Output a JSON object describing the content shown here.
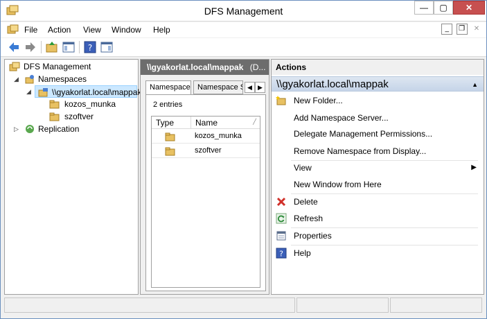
{
  "window": {
    "title": "DFS Management"
  },
  "titlebar": {
    "minimize": "—",
    "restore": "▢",
    "close": "✕"
  },
  "menu": {
    "items": [
      "File",
      "Action",
      "View",
      "Window",
      "Help"
    ],
    "mdi": {
      "minimize": "_",
      "restore": "❐",
      "close": "✕"
    }
  },
  "tree": {
    "root": "DFS Management",
    "namespaces": "Namespaces",
    "namespace_node": "\\\\gyakorlat.local\\mappak",
    "children": [
      "kozos_munka",
      "szoftver"
    ],
    "replication": "Replication"
  },
  "center": {
    "header": "\\\\gyakorlat.local\\mappak",
    "header_suffix": "(D...",
    "tabs": [
      "Namespace",
      "Namespace Se"
    ],
    "entries": "2 entries",
    "columns": [
      "Type",
      "Name"
    ],
    "rows": [
      {
        "name": "kozos_munka"
      },
      {
        "name": "szoftver"
      }
    ]
  },
  "actions": {
    "header": "Actions",
    "section": "\\\\gyakorlat.local\\mappak",
    "items": [
      {
        "label": "New Folder...",
        "icon": "new-folder-icon"
      },
      {
        "label": "Add Namespace Server...",
        "icon": ""
      },
      {
        "label": "Delegate Management Permissions...",
        "icon": ""
      },
      {
        "label": "Remove Namespace from Display...",
        "icon": ""
      },
      {
        "label": "View",
        "icon": "",
        "submenu": true
      },
      {
        "label": "New Window from Here",
        "icon": ""
      },
      {
        "label": "Delete",
        "icon": "delete-icon"
      },
      {
        "label": "Refresh",
        "icon": "refresh-icon"
      },
      {
        "label": "Properties",
        "icon": "properties-icon"
      },
      {
        "label": "Help",
        "icon": "help-icon"
      }
    ]
  },
  "colors": {
    "accent_header": "#6d6d6d",
    "section_bar": "#c5d4e8",
    "selection": "#cce8ff",
    "close_button": "#c75050"
  }
}
